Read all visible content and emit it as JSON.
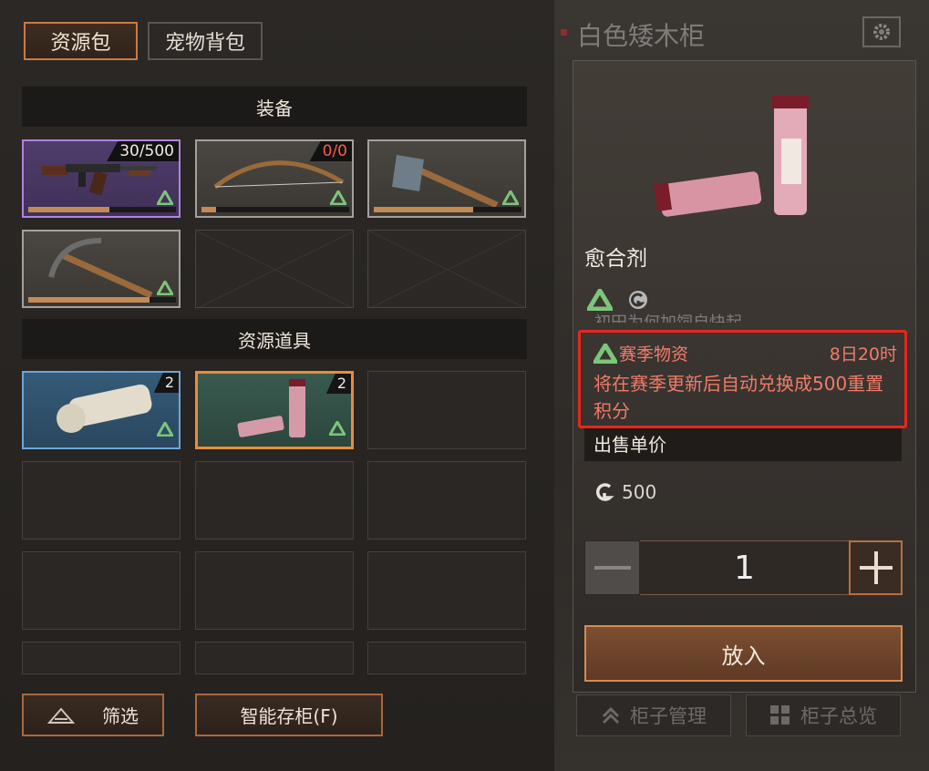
{
  "tabs": {
    "active": "资源包",
    "inactive": "宠物背包"
  },
  "sections": {
    "equipment": "装备",
    "resources": "资源道具"
  },
  "equipment": [
    {
      "name": "ak-rifle",
      "count": "30/500",
      "count_color": "white",
      "durability": 0.55,
      "rarity": "purple"
    },
    {
      "name": "bow",
      "count": "0/0",
      "count_color": "red",
      "durability": 0.1,
      "rarity": "gray"
    },
    {
      "name": "axe",
      "count": "",
      "durability": 0.67,
      "rarity": "gray"
    },
    {
      "name": "pickaxe",
      "count": "",
      "durability": 0.82,
      "rarity": "gray"
    }
  ],
  "resources": [
    {
      "name": "bandage",
      "qty": "2",
      "rarity": "blue"
    },
    {
      "name": "healing-liquid",
      "qty": "2",
      "rarity": "green",
      "selected": true
    }
  ],
  "bottom_buttons": {
    "filter": "筛选",
    "smart_store": "智能存柜(F)"
  },
  "cabinet": {
    "title": "白色矮木柜"
  },
  "detail": {
    "item_name": "愈合剂",
    "ghost_text": "初田为何加饲自快起",
    "season_label": "赛季物资",
    "season_timer": "8日20时",
    "season_desc": "将在赛季更新后自动兑换成500重置积分",
    "price_header": "出售单价",
    "price_value": "500",
    "quantity": "1",
    "put_button": "放入"
  },
  "cabinet_buttons": {
    "manage": "柜子管理",
    "overview": "柜子总览"
  },
  "colors": {
    "accent": "#c97a44",
    "season_green": "#7cc57a",
    "warning_red": "#e8261c",
    "season_text": "#f07b68"
  }
}
